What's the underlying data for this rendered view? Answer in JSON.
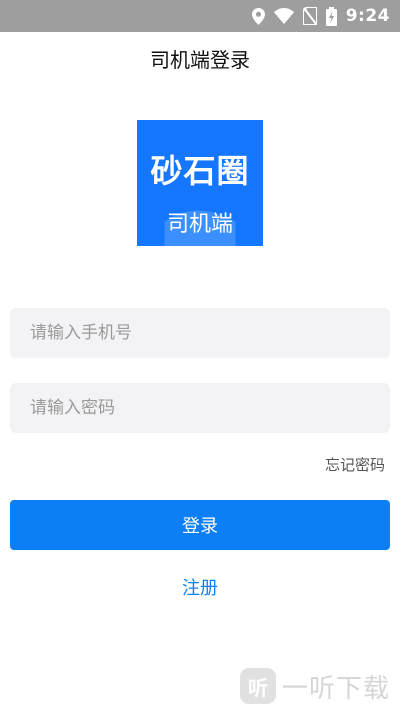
{
  "status_bar": {
    "time": "9:24",
    "icons": [
      "location-icon",
      "wifi-icon",
      "no-sim-icon",
      "battery-charging-icon"
    ]
  },
  "header": {
    "title": "司机端登录"
  },
  "logo": {
    "main_text": "砂石圈",
    "sub_text": "司机端"
  },
  "form": {
    "phone_placeholder": "请输入手机号",
    "phone_value": "",
    "password_placeholder": "请输入密码",
    "password_value": "",
    "forgot_label": "忘记密码",
    "login_label": "登录",
    "register_label": "注册"
  },
  "watermark": {
    "text": "一听下载",
    "icon_glyph": "听"
  },
  "colors": {
    "status_bar": "#9e9e9e",
    "brand_blue": "#1576ff",
    "button_blue": "#0d7ff6",
    "input_bg": "#f3f3f5"
  }
}
